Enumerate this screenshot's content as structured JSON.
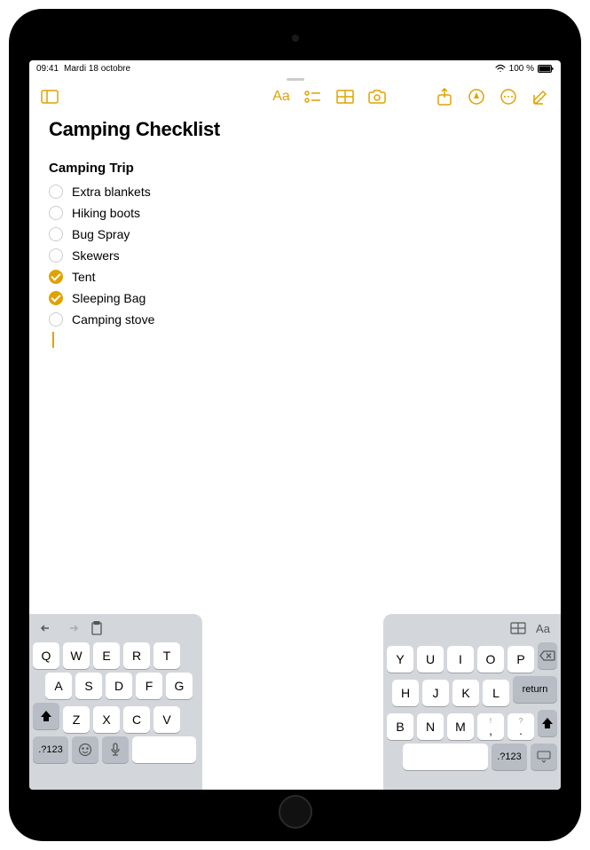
{
  "status": {
    "time": "09:41",
    "date": "Mardi 18 octobre",
    "battery_pct": "100 %"
  },
  "note": {
    "title": "Camping Checklist",
    "subtitle": "Camping Trip",
    "items": [
      {
        "label": "Extra blankets",
        "checked": false
      },
      {
        "label": "Hiking boots",
        "checked": false
      },
      {
        "label": "Bug Spray",
        "checked": false
      },
      {
        "label": "Skewers",
        "checked": false
      },
      {
        "label": "Tent",
        "checked": true
      },
      {
        "label": "Sleeping Bag",
        "checked": true
      },
      {
        "label": "Camping stove",
        "checked": false
      }
    ]
  },
  "keyboard": {
    "left": {
      "row1": [
        "Q",
        "W",
        "E",
        "R",
        "T"
      ],
      "row2": [
        "A",
        "S",
        "D",
        "F",
        "G"
      ],
      "row3": [
        "Z",
        "X",
        "C",
        "V"
      ],
      "num_label": ".?123"
    },
    "right": {
      "row1": [
        "Y",
        "U",
        "I",
        "O",
        "P"
      ],
      "row2": [
        "H",
        "J",
        "K",
        "L"
      ],
      "row3": [
        "B",
        "N",
        "M",
        "!",
        ",",
        "?",
        "."
      ],
      "return_label": "return",
      "num_label": ".?123"
    }
  },
  "colors": {
    "accent": "#e1a200"
  }
}
